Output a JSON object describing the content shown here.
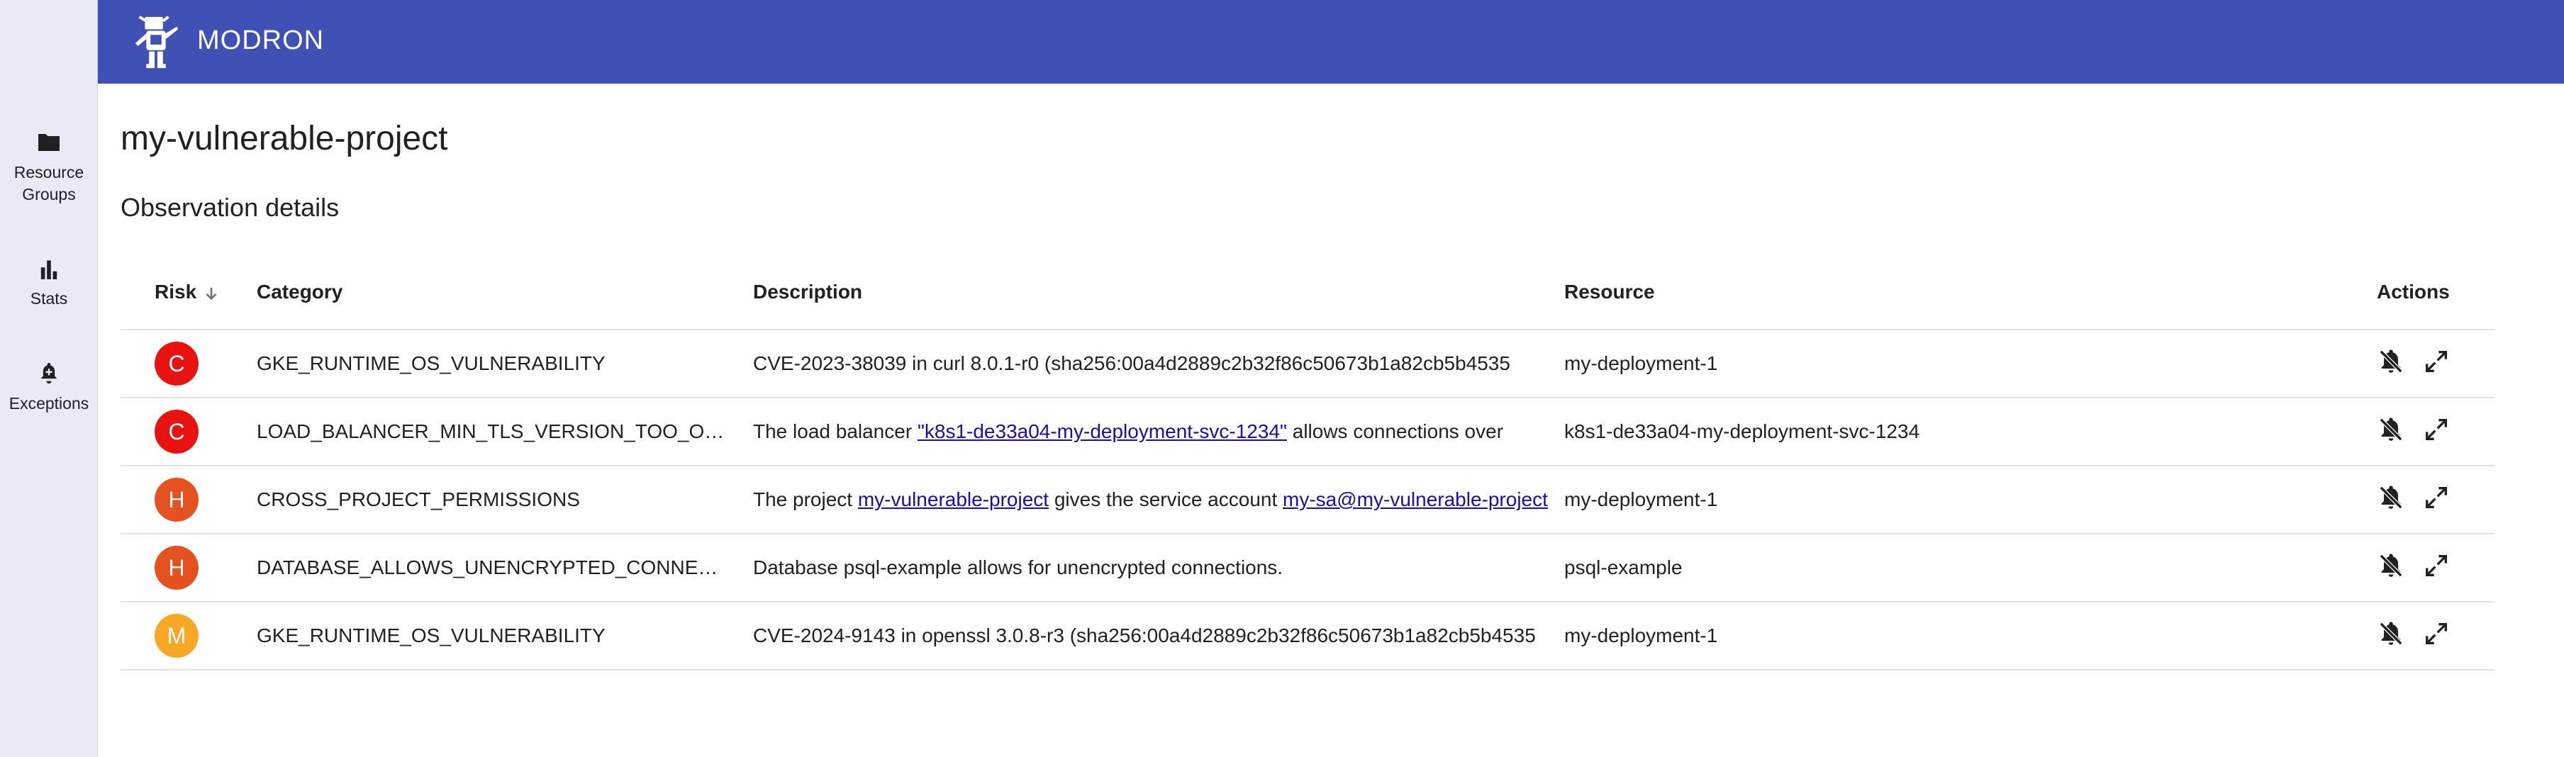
{
  "app": {
    "brand": "MODRON"
  },
  "nav": {
    "resource_groups": "Resource Groups",
    "stats": "Stats",
    "exceptions": "Exceptions"
  },
  "page": {
    "title": "my-vulnerable-project",
    "section": "Observation details"
  },
  "table": {
    "headers": {
      "risk": "Risk",
      "category": "Category",
      "description": "Description",
      "resource": "Resource",
      "actions": "Actions"
    },
    "rows": [
      {
        "risk": "C",
        "category": "GKE_RUNTIME_OS_VULNERABILITY",
        "description": {
          "pre": "CVE-2023-38039 in curl 8.0.1-r0 (sha256:00a4d2889c2b32f86c50673b1a82cb5b4535",
          "link1": "",
          "mid": "",
          "link2": ""
        },
        "resource": "my-deployment-1"
      },
      {
        "risk": "C",
        "category": "LOAD_BALANCER_MIN_TLS_VERSION_TOO_OLD",
        "description": {
          "pre": "The load balancer ",
          "link1": "\"k8s1-de33a04-my-deployment-svc-1234\"",
          "mid": " allows connections over",
          "link2": ""
        },
        "resource": "k8s1-de33a04-my-deployment-svc-1234"
      },
      {
        "risk": "H",
        "category": "CROSS_PROJECT_PERMISSIONS",
        "description": {
          "pre": "The project ",
          "link1": "my-vulnerable-project",
          "mid": " gives the service account ",
          "link2": "my-sa@my-vulnerable-project"
        },
        "resource": "my-deployment-1"
      },
      {
        "risk": "H",
        "category": "DATABASE_ALLOWS_UNENCRYPTED_CONNECTIONS",
        "description": {
          "pre": "Database psql-example allows for unencrypted connections.",
          "link1": "",
          "mid": "",
          "link2": ""
        },
        "resource": "psql-example"
      },
      {
        "risk": "M",
        "category": "GKE_RUNTIME_OS_VULNERABILITY",
        "description": {
          "pre": "CVE-2024-9143 in openssl 3.0.8-r3 (sha256:00a4d2889c2b32f86c50673b1a82cb5b4535",
          "link1": "",
          "mid": "",
          "link2": ""
        },
        "resource": "my-deployment-1"
      }
    ]
  },
  "icons": {
    "resource_groups": "folder-icon",
    "stats": "bar-chart-icon",
    "exceptions": "bell-plus-icon",
    "sort": "arrow-down-icon",
    "mute": "bell-off-icon",
    "expand": "expand-icon"
  },
  "colors": {
    "app_bar": "#3f51b5",
    "rail": "#e8eaf6",
    "risk_C": "#e8130f",
    "risk_H": "#e6521f",
    "risk_M": "#f9a825",
    "link": "#1a0dab"
  }
}
